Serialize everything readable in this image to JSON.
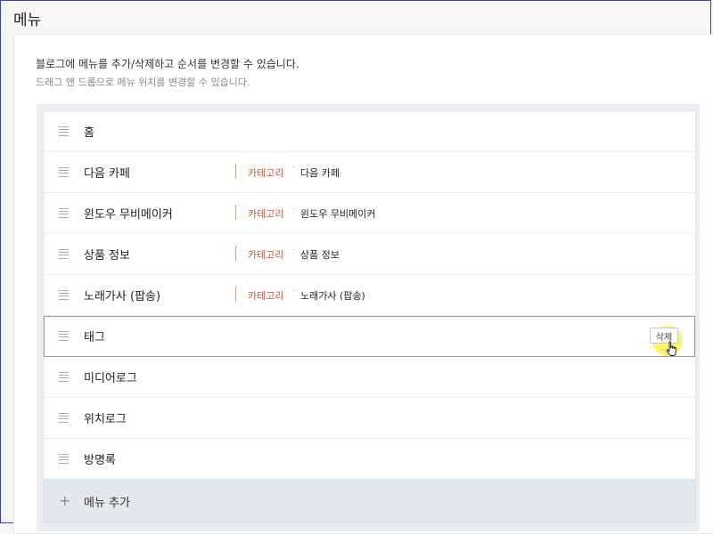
{
  "page": {
    "title": "메뉴"
  },
  "description": {
    "line1": "블로그에 메뉴를 추가/삭제하고 순서를 변경할 수 있습니다.",
    "line2": "드래그 앤 드롭으로 메뉴 위치를 변경할 수 있습니다."
  },
  "menu": {
    "items": [
      {
        "name": "홈"
      },
      {
        "name": "다음 카페",
        "type_label": "카테고리",
        "dot": "·",
        "category": "다음 카페"
      },
      {
        "name": "윈도우 무비메이커",
        "type_label": "카테고리",
        "dot": "·",
        "category": "윈도우 무비메이커"
      },
      {
        "name": "상품 정보",
        "type_label": "카테고리",
        "dot": "·",
        "category": "상품 정보"
      },
      {
        "name": "노래가사 (팝송)",
        "type_label": "카테고리",
        "dot": "·",
        "category": "노래가사 (팝송)"
      },
      {
        "name": "태그",
        "delete_label": "삭제"
      },
      {
        "name": "미디어로그"
      },
      {
        "name": "위치로그"
      },
      {
        "name": "방명록"
      }
    ],
    "add_label": "메뉴 추가"
  },
  "colors": {
    "category_accent": "#c0583a",
    "highlight": "#fff03c",
    "frame_border": "#3b3bd0"
  },
  "icons": {
    "drag_handle": "drag-handle-icon",
    "plus": "plus-icon",
    "cursor": "hand-pointer-icon"
  }
}
